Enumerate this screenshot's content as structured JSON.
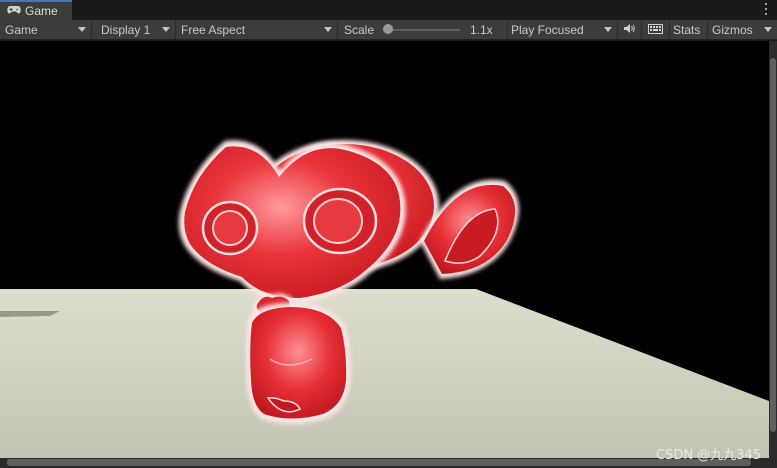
{
  "tab": {
    "label": "Game",
    "icon": "gamepad-icon"
  },
  "toolbar": {
    "view_mode": "Game",
    "display": "Display 1",
    "aspect": "Free Aspect",
    "scale_label": "Scale",
    "scale_value": "1.1x",
    "play_mode": "Play Focused",
    "stats_label": "Stats",
    "gizmos_label": "Gizmos"
  },
  "icons": {
    "tab": "gamepad-icon",
    "audio": "speaker-icon",
    "keyboard": "keyboard-icon",
    "menu": "kebab-menu-icon"
  },
  "colors": {
    "accent": "#3a79bb",
    "model": "#e8343a",
    "rim": "#ffe6e6",
    "floor": "#d6d6c6"
  },
  "watermark": "CSDN @九九345"
}
